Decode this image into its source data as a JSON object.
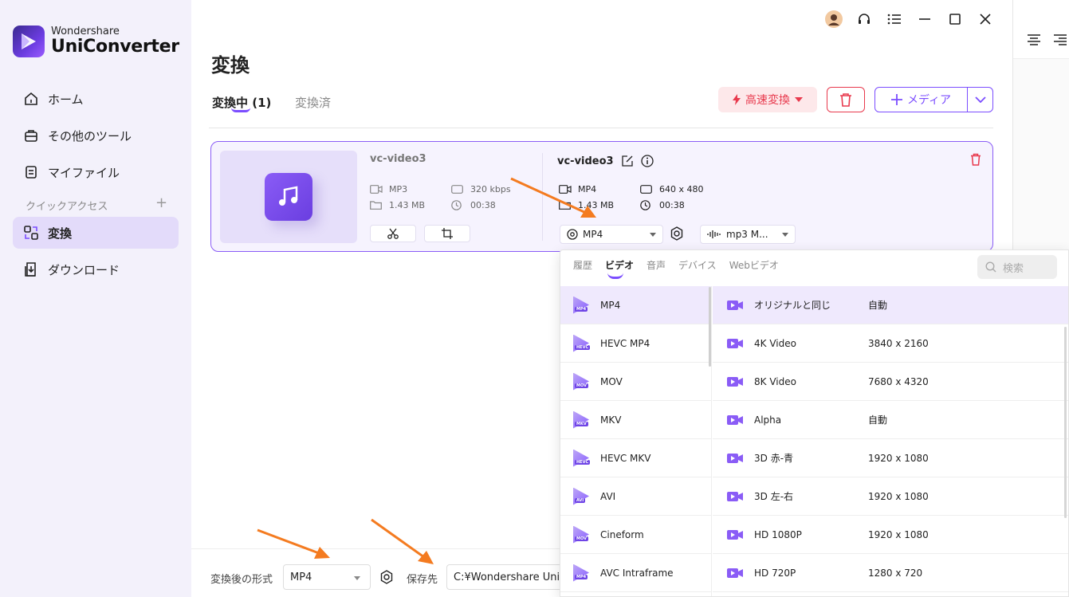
{
  "brand": {
    "small": "Wondershare",
    "big": "UniConverter"
  },
  "sidebar": {
    "items": [
      {
        "label": "ホーム",
        "icon": "home-icon"
      },
      {
        "label": "その他のツール",
        "icon": "toolbox-icon"
      },
      {
        "label": "マイファイル",
        "icon": "file-icon"
      },
      {
        "label": "変換",
        "icon": "convert-icon",
        "active": true
      },
      {
        "label": "ダウンロード",
        "icon": "download-icon"
      }
    ],
    "quick_access": "クイックアクセス",
    "quick_plus": "+"
  },
  "main": {
    "title": "変換",
    "tabs": [
      {
        "label": "変換中 (1)"
      },
      {
        "label": "変換済"
      }
    ],
    "buttons": {
      "fast": "高速変換",
      "media": "メディア"
    }
  },
  "card": {
    "source": {
      "name": "vc-video3",
      "format": "MP3",
      "bitrate": "320 kbps",
      "size": "1.43 MB",
      "duration": "00:38"
    },
    "output": {
      "name": "vc-video3",
      "format": "MP4",
      "resolution": "640 x 480",
      "size": "1.43 MB",
      "duration": "00:38"
    },
    "format_select": "MP4",
    "audio_select": "mp3 M..."
  },
  "bottom": {
    "format_label": "変換後の形式",
    "format_value": "MP4",
    "save_label": "保存先",
    "save_path": "C:¥Wondershare UniC"
  },
  "panel": {
    "tabs": [
      "履歴",
      "ビデオ",
      "音声",
      "デバイス",
      "Webビデオ"
    ],
    "active_tab": "ビデオ",
    "search_placeholder": "検索",
    "formats": [
      {
        "name": "MP4",
        "tag": "MP4"
      },
      {
        "name": "HEVC MP4",
        "tag": "HEVC"
      },
      {
        "name": "MOV",
        "tag": "MOV"
      },
      {
        "name": "MKV",
        "tag": "MKV"
      },
      {
        "name": "HEVC MKV",
        "tag": "HEVC"
      },
      {
        "name": "AVI",
        "tag": "AVI"
      },
      {
        "name": "Cineform",
        "tag": "MOV"
      },
      {
        "name": "AVC Intraframe",
        "tag": "MP4"
      }
    ],
    "resolutions": [
      {
        "name": "オリジナルと同じ",
        "res": "自動"
      },
      {
        "name": "4K Video",
        "res": "3840 x 2160"
      },
      {
        "name": "8K Video",
        "res": "7680 x 4320"
      },
      {
        "name": "Alpha",
        "res": "自動"
      },
      {
        "name": "3D 赤-青",
        "res": "1920 x 1080"
      },
      {
        "name": "3D 左-右",
        "res": "1920 x 1080"
      },
      {
        "name": "HD 1080P",
        "res": "1920 x 1080"
      },
      {
        "name": "HD 720P",
        "res": "1280 x 720"
      }
    ]
  },
  "colors": {
    "accent": "#7b4dff",
    "danger": "#e8394d",
    "arrow": "#f47b20"
  }
}
